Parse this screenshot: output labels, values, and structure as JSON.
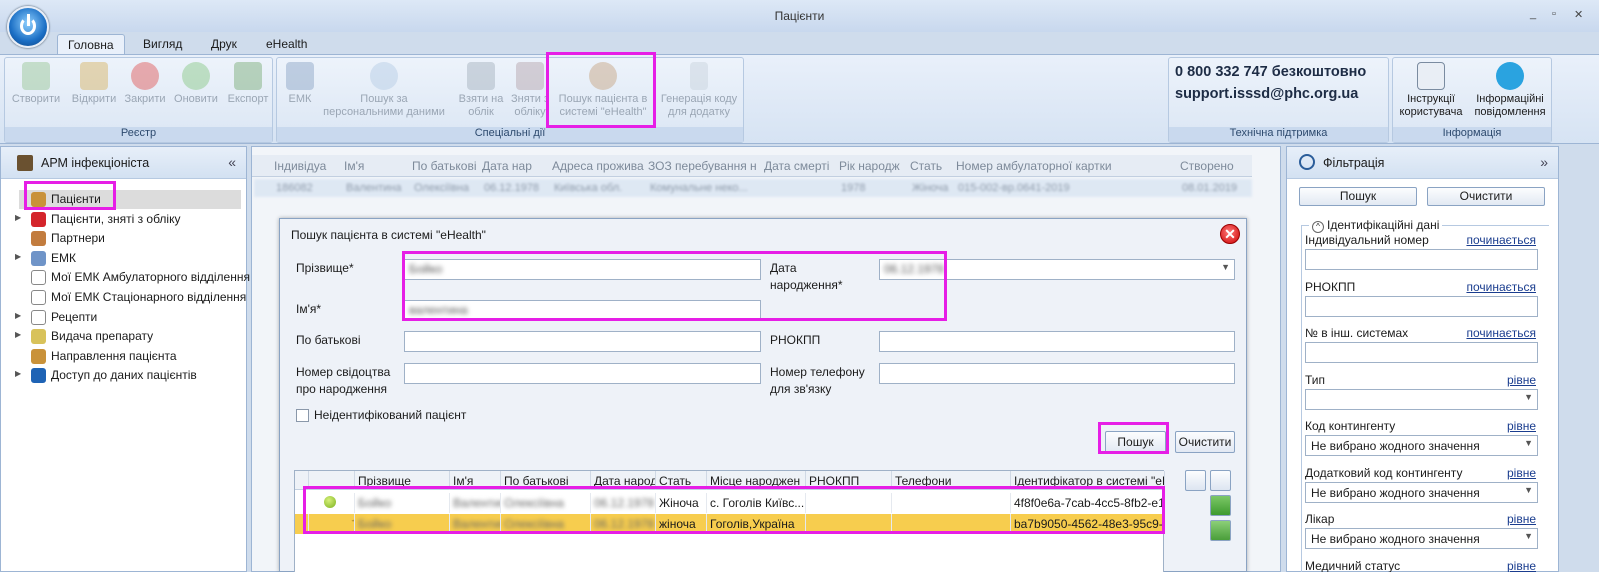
{
  "window": {
    "title": "Пацієнти",
    "controls": [
      "_",
      "▫",
      "✕"
    ]
  },
  "tabs": [
    "Головна",
    "Вигляд",
    "Друк",
    "eHealth"
  ],
  "ribbon": {
    "registry": {
      "title": "Реєстр",
      "buttons": [
        "Створити",
        "Відкрити",
        "Закрити",
        "Оновити",
        "Експорт"
      ]
    },
    "special": {
      "title": "Спеціальні дії",
      "buttons": [
        {
          "l1": "ЕМК",
          "l2": ""
        },
        {
          "l1": "Пошук за",
          "l2": "персональними даними"
        },
        {
          "l1": "Взяти на",
          "l2": "облік"
        },
        {
          "l1": "Зняти з",
          "l2": "обліку"
        },
        {
          "l1": "Пошук пацієнта в",
          "l2": "системі \"eHealth\""
        },
        {
          "l1": "Генерація коду",
          "l2": "для додатку"
        }
      ]
    },
    "support": {
      "title": "Технічна підтримка",
      "phone": "0 800 332 747 безкоштовно",
      "email": "support.isssd@phc.org.ua"
    },
    "info": {
      "title": "Інформація",
      "buttons": [
        {
          "l1": "Інструкції",
          "l2": "користувача"
        },
        {
          "l1": "Інформаційні",
          "l2": "повідомлення"
        }
      ]
    }
  },
  "left_panel": {
    "title": "АРМ інфекціоніста",
    "collapse": "«",
    "items": [
      {
        "label": "Пацієнти",
        "arrow": "",
        "color": "#c9923a"
      },
      {
        "label": "Пацієнти, зняті з обліку",
        "arrow": "▶",
        "color": "#d4252b"
      },
      {
        "label": "Партнери",
        "arrow": "",
        "color": "#c27c3e"
      },
      {
        "label": "ЕМК",
        "arrow": "▶",
        "color": "#6f94c8"
      },
      {
        "label": "Мої ЕМК Амбулаторного відділення",
        "arrow": "",
        "color": "#ffffff"
      },
      {
        "label": "Мої ЕМК Стаціонарного відділення",
        "arrow": "",
        "color": "#ffffff"
      },
      {
        "label": "Рецепти",
        "arrow": "▶",
        "color": "#ffffff"
      },
      {
        "label": "Видача препарату",
        "arrow": "▶",
        "color": "#d8c25a"
      },
      {
        "label": "Направлення пацієнта",
        "arrow": "",
        "color": "#c9923a"
      },
      {
        "label": "Доступ до даних пацієнтів",
        "arrow": "▶",
        "color": "#1e63b5"
      }
    ]
  },
  "main_grid": {
    "headers": [
      "Індивідуа",
      "Ім'я",
      "По батькові",
      "Дата нар",
      "Адреса прожива",
      "ЗОЗ перебування н",
      "Дата смерті",
      "Рік народж",
      "Стать",
      "Номер амбулаторної картки",
      "Створено"
    ],
    "row": [
      "186082",
      "Валентина",
      "Олексіївна",
      "06.12.1978",
      "Київська обл.",
      "Комунальне неко...",
      "",
      "1978",
      "Жіноча",
      "015-002-вр.0641-2019",
      "08.01.2019"
    ]
  },
  "dialog": {
    "title": "Пошук пацієнта в системі \"eHealth\"",
    "close": "✕",
    "labels": {
      "surname": "Прізвище*",
      "name": "Ім'я*",
      "patronymic": "По батькові",
      "birth_cert_l1": "Номер свідоцтва",
      "birth_cert_l2": "про народження",
      "dob_l1": "Дата",
      "dob_l2": "народження*",
      "rnokpp": "РНОКПП",
      "phone_l1": "Номер телефону",
      "phone_l2": "для зв'язку",
      "unidentified": "Неідентифікований пацієнт"
    },
    "values": {
      "surname": "Бойко",
      "name": "валентина",
      "dob": "06.12.1978"
    },
    "search_button": "Пошук",
    "clear_button": "Очистити",
    "results": {
      "headers": [
        "",
        "",
        "Прізвище",
        "Ім'я",
        "По батькові",
        "Дата народ",
        "Стать",
        "Місце народжен",
        "РНОКПП",
        "Телефони",
        "Ідентифікатор в системі \"eH"
      ],
      "rows": [
        {
          "surname": "Бойко",
          "name": "Валентина",
          "patronymic": "Олексіївна",
          "dob": "06.12.1978",
          "sex": "Жіноча",
          "birthplace": "с. Гоголів Київс...",
          "rnokpp": "",
          "phones": "",
          "id": "4f8f0e6a-7cab-4cc5-8fb2-e1",
          "status": "green-dot"
        },
        {
          "surname": "Бойко",
          "name": "Валентина",
          "patronymic": "Олексіївна",
          "dob": "06.12.1978",
          "sex": "жіноча",
          "birthplace": "Гоголів,Україна",
          "rnokpp": "",
          "phones": "",
          "id": "ba7b9050-4562-48e3-95c9-f",
          "status": "caduceus"
        }
      ]
    }
  },
  "right_panel": {
    "title": "Фільтрація",
    "collapse": "»",
    "search_button": "Пошук",
    "clear_button": "Очистити",
    "section": "Ідентифікаційні дані",
    "fields": [
      {
        "label": "Індивідуальний номер",
        "mode": "починається",
        "value": ""
      },
      {
        "label": "РНОКПП",
        "mode": "починається",
        "value": ""
      },
      {
        "label": "№ в інш. системах",
        "mode": "починається",
        "value": ""
      },
      {
        "label": "Тип",
        "mode": "рівне",
        "value": ""
      },
      {
        "label": "Код контингенту",
        "mode": "рівне",
        "value": "Не вибрано жодного значення"
      },
      {
        "label": "Додатковий код контингенту",
        "mode": "рівне",
        "value": "Не вибрано жодного значення"
      },
      {
        "label": "Лікар",
        "mode": "рівне",
        "value": "Не вибрано жодного значення"
      },
      {
        "label": "Медичний статус",
        "mode": "рівне",
        "value": ""
      }
    ]
  }
}
